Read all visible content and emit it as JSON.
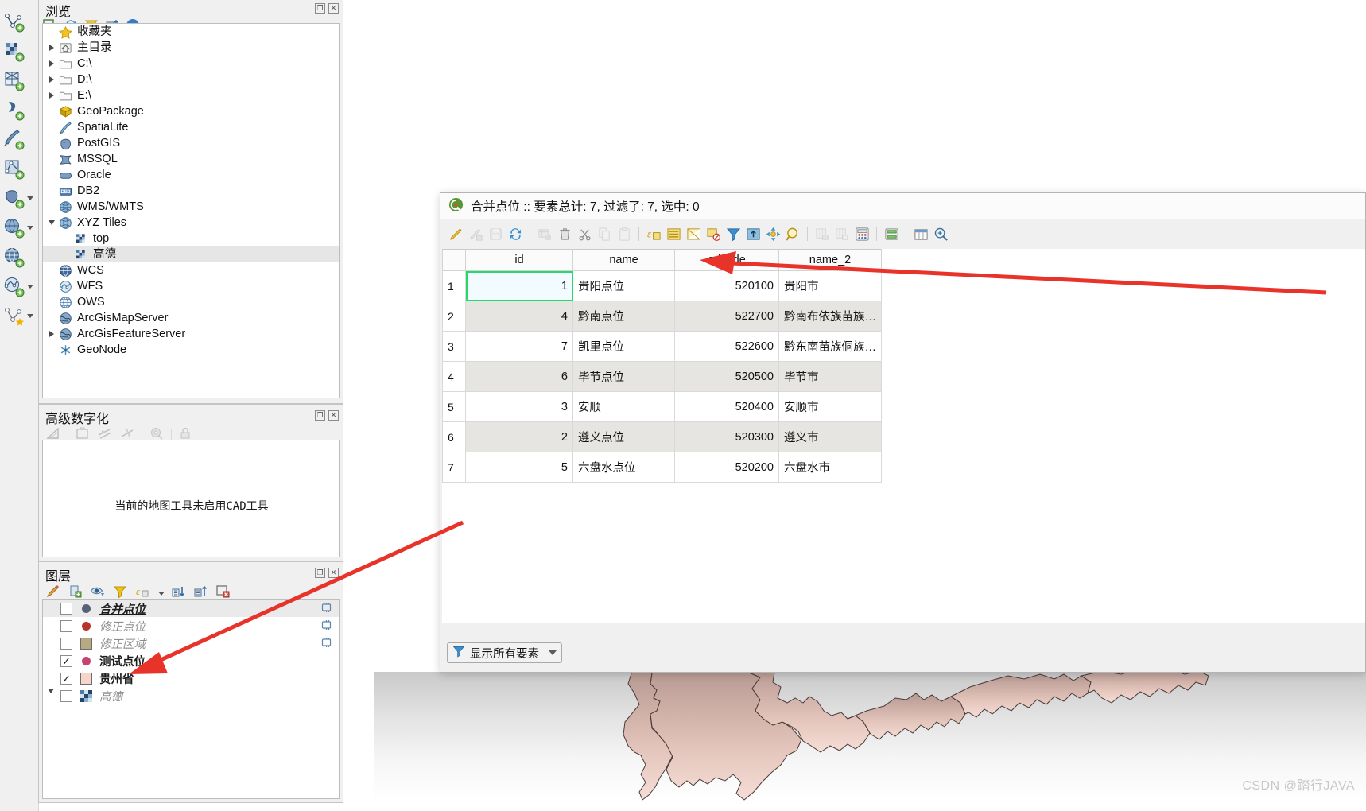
{
  "app": {
    "watermark": "CSDN @踏行JAVA",
    "accent_green": "#27d86a",
    "annotation_color": "#e8332a"
  },
  "left_toolbar": {
    "items": [
      {
        "name": "add-vector-layer-icon",
        "label": "添加矢量图层"
      },
      {
        "name": "add-raster-layer-icon",
        "label": "添加栅格图层"
      },
      {
        "name": "add-mesh-layer-icon",
        "label": "添加网格图层"
      },
      {
        "name": "add-delimited-text-layer-icon",
        "label": "添加分隔文本图层"
      },
      {
        "name": "add-spatialite-layer-icon",
        "label": "添加SpatiaLite图层"
      },
      {
        "name": "add-vector-tile-layer-icon",
        "label": "添加矢量瓦片图层"
      },
      {
        "name": "add-postgis-layer-icon",
        "label": "添加PostGIS图层",
        "has_dropdown": true
      },
      {
        "name": "add-wms-layer-icon",
        "label": "添加WMS/WMTS图层",
        "has_dropdown": true
      },
      {
        "name": "add-wcs-layer-icon",
        "label": "添加WCS图层"
      },
      {
        "name": "add-wfs-layer-icon",
        "label": "添加WFS图层",
        "has_dropdown": true
      },
      {
        "name": "new-virtual-layer-icon",
        "label": "新建虚拟图层",
        "has_dropdown": true
      }
    ]
  },
  "browser": {
    "title": "浏览",
    "toolbar": [
      {
        "name": "add-layer-icon",
        "label": "添加选中图层"
      },
      {
        "name": "refresh-icon",
        "label": "刷新"
      },
      {
        "name": "filter-icon",
        "label": "过滤浏览器"
      },
      {
        "name": "collapse-all-icon",
        "label": "折叠全部"
      },
      {
        "name": "properties-icon",
        "label": "属性"
      }
    ],
    "tree": [
      {
        "label": "收藏夹",
        "icon": "star-icon",
        "indent": 1,
        "twisty": "none",
        "selected": false
      },
      {
        "label": "主目录",
        "icon": "home-folder-icon",
        "indent": 1,
        "twisty": "right",
        "selected": false
      },
      {
        "label": "C:\\",
        "icon": "folder-icon",
        "indent": 1,
        "twisty": "right",
        "selected": false
      },
      {
        "label": "D:\\",
        "icon": "folder-icon",
        "indent": 1,
        "twisty": "right",
        "selected": false
      },
      {
        "label": "E:\\",
        "icon": "folder-icon",
        "indent": 1,
        "twisty": "right",
        "selected": false
      },
      {
        "label": "GeoPackage",
        "icon": "geopackage-icon",
        "indent": 1,
        "twisty": "none",
        "selected": false
      },
      {
        "label": "SpatiaLite",
        "icon": "spatialite-icon",
        "indent": 1,
        "twisty": "none",
        "selected": false
      },
      {
        "label": "PostGIS",
        "icon": "postgis-icon",
        "indent": 1,
        "twisty": "none",
        "selected": false
      },
      {
        "label": "MSSQL",
        "icon": "mssql-icon",
        "indent": 1,
        "twisty": "none",
        "selected": false
      },
      {
        "label": "Oracle",
        "icon": "oracle-icon",
        "indent": 1,
        "twisty": "none",
        "selected": false
      },
      {
        "label": "DB2",
        "icon": "db2-icon",
        "indent": 1,
        "twisty": "none",
        "selected": false
      },
      {
        "label": "WMS/WMTS",
        "icon": "globe-icon",
        "indent": 1,
        "twisty": "none",
        "selected": false
      },
      {
        "label": "XYZ Tiles",
        "icon": "globe-icon",
        "indent": 1,
        "twisty": "down",
        "selected": false
      },
      {
        "label": "top",
        "icon": "tile-icon",
        "indent": 2,
        "twisty": "none",
        "selected": false
      },
      {
        "label": "高德",
        "icon": "tile-icon",
        "indent": 2,
        "twisty": "none",
        "selected": true
      },
      {
        "label": "WCS",
        "icon": "wcs-icon",
        "indent": 1,
        "twisty": "none",
        "selected": false
      },
      {
        "label": "WFS",
        "icon": "wfs-icon",
        "indent": 1,
        "twisty": "none",
        "selected": false
      },
      {
        "label": "OWS",
        "icon": "ows-icon",
        "indent": 1,
        "twisty": "none",
        "selected": false
      },
      {
        "label": "ArcGisMapServer",
        "icon": "arcgis-icon",
        "indent": 1,
        "twisty": "none",
        "selected": false
      },
      {
        "label": "ArcGisFeatureServer",
        "icon": "arcgis-icon",
        "indent": 1,
        "twisty": "right",
        "selected": false
      },
      {
        "label": "GeoNode",
        "icon": "geonode-icon",
        "indent": 1,
        "twisty": "none",
        "selected": false
      }
    ]
  },
  "advanced_digitizing": {
    "title": "高级数字化",
    "message": "当前的地图工具未启用CAD工具",
    "toolbar": [
      {
        "name": "enable-advanced-digitizing-icon",
        "label": "启用高级数字化工具"
      },
      {
        "name": "construction-mode-icon",
        "label": "构造模式"
      },
      {
        "name": "parallel-icon",
        "label": "平行"
      },
      {
        "name": "perpendicular-icon",
        "label": "垂直"
      },
      {
        "name": "snap-settings-icon",
        "label": "吸附设置"
      },
      {
        "name": "lock-icon",
        "label": "锁定"
      }
    ]
  },
  "layers": {
    "title": "图层",
    "toolbar": [
      {
        "name": "layer-styling-icon",
        "label": "打开图层样式面板"
      },
      {
        "name": "add-group-icon",
        "label": "添加组"
      },
      {
        "name": "manage-visibility-icon",
        "label": "管理图层可见性"
      },
      {
        "name": "filter-legend-icon",
        "label": "过滤图例"
      },
      {
        "name": "expression-filter-icon",
        "label": "表达式过滤图例",
        "has_dropdown": true
      },
      {
        "name": "expand-all-icon",
        "label": "展开全部"
      },
      {
        "name": "collapse-all-icon",
        "label": "折叠全部"
      },
      {
        "name": "remove-layer-icon",
        "label": "移除图层/组"
      }
    ],
    "items": [
      {
        "label": "合并点位",
        "checked": false,
        "symbol": "point",
        "color": "#58607a",
        "bold": true,
        "italic": true,
        "underline": true,
        "dim": false,
        "memory": true,
        "selected": true,
        "twisty": "none"
      },
      {
        "label": "修正点位",
        "checked": false,
        "symbol": "point",
        "color": "#b9322c",
        "bold": false,
        "italic": true,
        "underline": false,
        "dim": true,
        "memory": true,
        "selected": false,
        "twisty": "none"
      },
      {
        "label": "修正区域",
        "checked": false,
        "symbol": "polygon",
        "color": "#b8a982",
        "bold": false,
        "italic": true,
        "underline": false,
        "dim": true,
        "memory": true,
        "selected": false,
        "twisty": "none"
      },
      {
        "label": "测试点位",
        "checked": true,
        "symbol": "point",
        "color": "#c8436f",
        "bold": true,
        "italic": false,
        "underline": false,
        "dim": false,
        "memory": false,
        "selected": false,
        "twisty": "none"
      },
      {
        "label": "贵州省",
        "checked": true,
        "symbol": "polygon",
        "color": "#f6d6cb",
        "bold": true,
        "italic": false,
        "underline": false,
        "dim": false,
        "memory": false,
        "selected": false,
        "twisty": "none"
      },
      {
        "label": "高德",
        "checked": false,
        "symbol": "tile",
        "color": "#5a86bf",
        "bold": false,
        "italic": true,
        "underline": false,
        "dim": true,
        "memory": false,
        "selected": false,
        "twisty": "down"
      }
    ]
  },
  "attribute_table": {
    "title": "合并点位 :: 要素总计: 7, 过滤了: 7, 选中: 0",
    "app_icon": "qgis-logo-icon",
    "toolbar": [
      {
        "name": "toggle-editing-icon",
        "label": "切换编辑模式",
        "enabled": true
      },
      {
        "name": "save-edits-icon",
        "label": "保存编辑",
        "enabled": false
      },
      {
        "name": "save-layer-edits-icon",
        "label": "保存图层编辑",
        "enabled": false
      },
      {
        "name": "reload-table-icon",
        "label": "重新载入表格",
        "enabled": true
      },
      {
        "name": "sep",
        "label": "分隔符"
      },
      {
        "name": "add-feature-icon",
        "label": "添加要素",
        "enabled": false
      },
      {
        "name": "delete-selected-icon",
        "label": "删除选中要素",
        "enabled": true
      },
      {
        "name": "cut-features-icon",
        "label": "剪切要素",
        "enabled": true
      },
      {
        "name": "copy-features-icon",
        "label": "复制要素",
        "enabled": false
      },
      {
        "name": "paste-features-icon",
        "label": "粘贴要素",
        "enabled": false
      },
      {
        "name": "sep",
        "label": "分隔符"
      },
      {
        "name": "select-by-expression-icon",
        "label": "使用表达式选择要素",
        "enabled": true
      },
      {
        "name": "select-all-icon",
        "label": "全选",
        "enabled": true
      },
      {
        "name": "invert-selection-icon",
        "label": "反选",
        "enabled": true
      },
      {
        "name": "deselect-all-icon",
        "label": "取消全选",
        "enabled": true
      },
      {
        "name": "filter-selection-icon",
        "label": "过滤选择",
        "enabled": true
      },
      {
        "name": "move-selection-to-top-icon",
        "label": "将选中行移至顶部",
        "enabled": true
      },
      {
        "name": "pan-to-selection-icon",
        "label": "平移至选中要素",
        "enabled": true
      },
      {
        "name": "zoom-to-selection-icon",
        "label": "缩放至选中要素",
        "enabled": true
      },
      {
        "name": "sep",
        "label": "分隔符"
      },
      {
        "name": "new-field-icon",
        "label": "新建字段",
        "enabled": false
      },
      {
        "name": "delete-field-icon",
        "label": "删除字段",
        "enabled": false
      },
      {
        "name": "open-field-calculator-icon",
        "label": "打开字段计算器",
        "enabled": true
      },
      {
        "name": "sep",
        "label": "分隔符"
      },
      {
        "name": "conditional-formatting-icon",
        "label": "条件格式",
        "enabled": true
      },
      {
        "name": "sep",
        "label": "分隔符"
      },
      {
        "name": "organize-columns-icon",
        "label": "组织列",
        "enabled": true
      },
      {
        "name": "actions-icon",
        "label": "动作",
        "enabled": true
      }
    ],
    "columns": [
      "id",
      "name",
      "adcode",
      "name_2"
    ],
    "rows": [
      {
        "n": "1",
        "id": "1",
        "name": "贵阳点位",
        "adcode": "520100",
        "name_2": "贵阳市"
      },
      {
        "n": "2",
        "id": "4",
        "name": "黔南点位",
        "adcode": "522700",
        "name_2": "黔南布依族苗族…"
      },
      {
        "n": "3",
        "id": "7",
        "name": "凯里点位",
        "adcode": "522600",
        "name_2": "黔东南苗族侗族…"
      },
      {
        "n": "4",
        "id": "6",
        "name": "毕节点位",
        "adcode": "520500",
        "name_2": "毕节市"
      },
      {
        "n": "5",
        "id": "3",
        "name": "安顺",
        "adcode": "520400",
        "name_2": "安顺市"
      },
      {
        "n": "6",
        "id": "2",
        "name": "遵义点位",
        "adcode": "520300",
        "name_2": "遵义市"
      },
      {
        "n": "7",
        "id": "5",
        "name": "六盘水点位",
        "adcode": "520200",
        "name_2": "六盘水市"
      }
    ],
    "selected_cell": {
      "row": 0,
      "column": "id"
    },
    "footer": {
      "show_all_label": "显示所有要素",
      "icon": "filter-icon"
    }
  }
}
